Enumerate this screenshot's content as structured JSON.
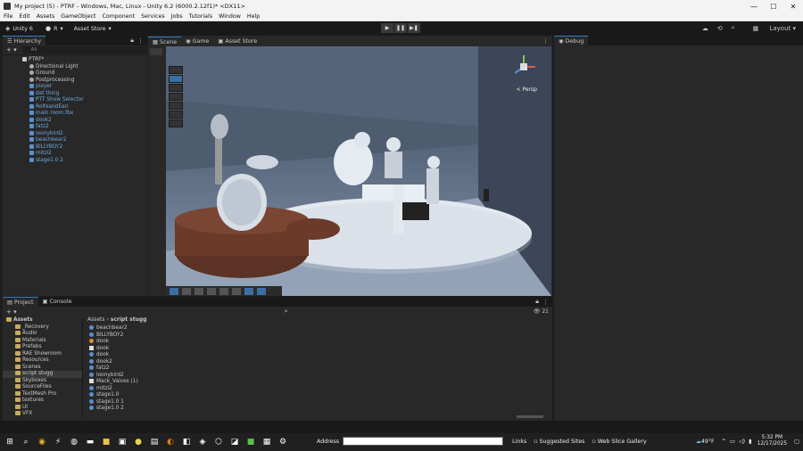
{
  "window": {
    "title": "My project (5) - PTRF - Windows, Mac, Linux - Unity 6.2 (6000.2.12f1)* <DX11>",
    "controls": [
      "—",
      "☐",
      "✕"
    ]
  },
  "menu": [
    "File",
    "Edit",
    "Assets",
    "GameObject",
    "Component",
    "Services",
    "Jobs",
    "Tutorials",
    "Window",
    "Help"
  ],
  "toolbar": {
    "account": "Unity 6",
    "r_label": "R",
    "asset_store": "Asset Store",
    "layout": "Layout"
  },
  "hierarchy": {
    "tab": "Hierarchy",
    "search_placeholder": "All",
    "root": "PTRF*",
    "items": [
      {
        "label": "Directional Light",
        "kind": "grey"
      },
      {
        "label": "Ground",
        "kind": "grey"
      },
      {
        "label": "Postprocessing",
        "kind": "grey"
      },
      {
        "label": "player",
        "kind": "blue"
      },
      {
        "label": "dat thing",
        "kind": "blue"
      },
      {
        "label": "PTT Show Selector",
        "kind": "blue"
      },
      {
        "label": "RolfeandEarl",
        "kind": "blue"
      },
      {
        "label": "main room.fbx",
        "kind": "blue"
      },
      {
        "label": "dook2",
        "kind": "blue"
      },
      {
        "label": "fatz2",
        "kind": "blue"
      },
      {
        "label": "loonybird2",
        "kind": "blue"
      },
      {
        "label": "beachbear2",
        "kind": "blue"
      },
      {
        "label": "BILLYBOY2",
        "kind": "blue"
      },
      {
        "label": "mitzi2",
        "kind": "blue"
      },
      {
        "label": "stage1.0 2",
        "kind": "blue"
      }
    ]
  },
  "scene": {
    "tabs": [
      "Scene",
      "Game",
      "Asset Store"
    ],
    "persp": "< Persp"
  },
  "debug": {
    "tab": "Debug"
  },
  "project": {
    "tabs": [
      "Project",
      "Console"
    ],
    "breadcrumb": [
      "Assets",
      "script stugg"
    ],
    "count": "21",
    "tree": [
      {
        "label": "Assets",
        "bold": true
      },
      {
        "label": "_Recovery"
      },
      {
        "label": "Audio"
      },
      {
        "label": "Materials"
      },
      {
        "label": "Prefabs"
      },
      {
        "label": "RAE Showroom"
      },
      {
        "label": "Resources"
      },
      {
        "label": "Scenes"
      },
      {
        "label": "script stugg",
        "selected": true
      },
      {
        "label": "Skyboxes"
      },
      {
        "label": "SourceFiles"
      },
      {
        "label": "TextMesh Pro"
      },
      {
        "label": "textures"
      },
      {
        "label": "UI"
      },
      {
        "label": "VFX"
      }
    ],
    "files": [
      {
        "label": "beachbear2",
        "icon": "blue"
      },
      {
        "label": "BILLYBOY2",
        "icon": "blue"
      },
      {
        "label": "dook",
        "icon": "orange"
      },
      {
        "label": "dook",
        "icon": "doc"
      },
      {
        "label": "dook",
        "icon": "blue"
      },
      {
        "label": "dook2",
        "icon": "blue"
      },
      {
        "label": "fatz2",
        "icon": "blue"
      },
      {
        "label": "loonybird2",
        "icon": "blue"
      },
      {
        "label": "Mack_Valves (1)",
        "icon": "doc"
      },
      {
        "label": "mitzi2",
        "icon": "blue"
      },
      {
        "label": "stage1.0",
        "icon": "blue"
      },
      {
        "label": "stage1.0 1",
        "icon": "blue"
      },
      {
        "label": "stage1.0 2",
        "icon": "blue"
      }
    ]
  },
  "taskbar": {
    "address_label": "Address",
    "links": "Links",
    "suggested": "Suggested Sites",
    "gallery": "Web Slice Gallery",
    "weather": "49°F",
    "time": "5:32 PM",
    "date": "12/17/2025"
  }
}
